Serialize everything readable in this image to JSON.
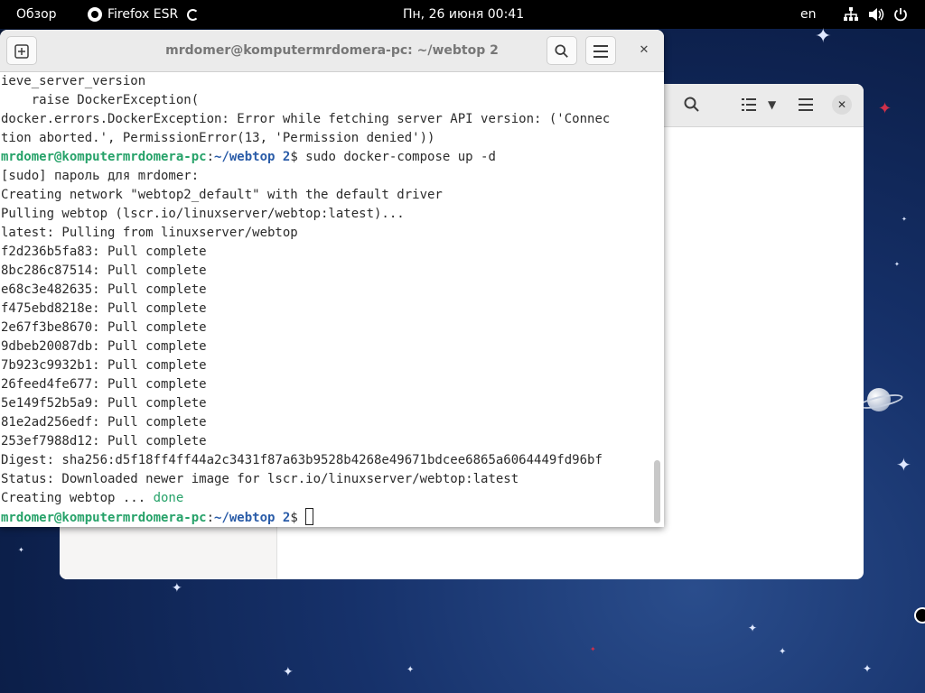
{
  "topbar": {
    "overview": "Обзор",
    "app_name": "Firefox ESR",
    "clock": "Пн, 26 июня  00:41",
    "language": "en",
    "icons": [
      "network-icon",
      "volume-icon",
      "power-icon"
    ]
  },
  "terminal": {
    "title": "mrdomer@komputermrdomera-pc: ~/webtop 2",
    "prompt_user": "mrdomer@komputermrdomera-pc",
    "prompt_path": "~/webtop 2",
    "lines": [
      "ieve_server_version",
      "    raise DockerException(",
      "docker.errors.DockerException: Error while fetching server API version: ('Connec",
      "tion aborted.', PermissionError(13, 'Permission denied'))",
      "",
      "[sudo] пароль для mrdomer:",
      "Creating network \"webtop2_default\" with the default driver",
      "Pulling webtop (lscr.io/linuxserver/webtop:latest)...",
      "latest: Pulling from linuxserver/webtop",
      "f2d236b5fa83: Pull complete",
      "8bc286c87514: Pull complete",
      "e68c3e482635: Pull complete",
      "f475ebd8218e: Pull complete",
      "2e67f3be8670: Pull complete",
      "9dbeb20087db: Pull complete",
      "7b923c9932b1: Pull complete",
      "26feed4fe677: Pull complete",
      "5e149f52b5a9: Pull complete",
      "81e2ad256edf: Pull complete",
      "253ef7988d12: Pull complete",
      "Digest: sha256:d5f18ff4ff44a2c3431f87a63b9528b4268e49671bdcee6865a6064449fd96bf",
      "Status: Downloaded newer image for lscr.io/linuxserver/webtop:latest",
      "Creating webtop ... ",
      ""
    ],
    "prompt_suffix": "$",
    "command_1": " sudo docker-compose up -d",
    "done_text": "done"
  },
  "colors": {
    "prompt_user": "#26a269",
    "prompt_path": "#2a5ca8",
    "done": "#26a269",
    "topbar_bg": "#000000"
  }
}
